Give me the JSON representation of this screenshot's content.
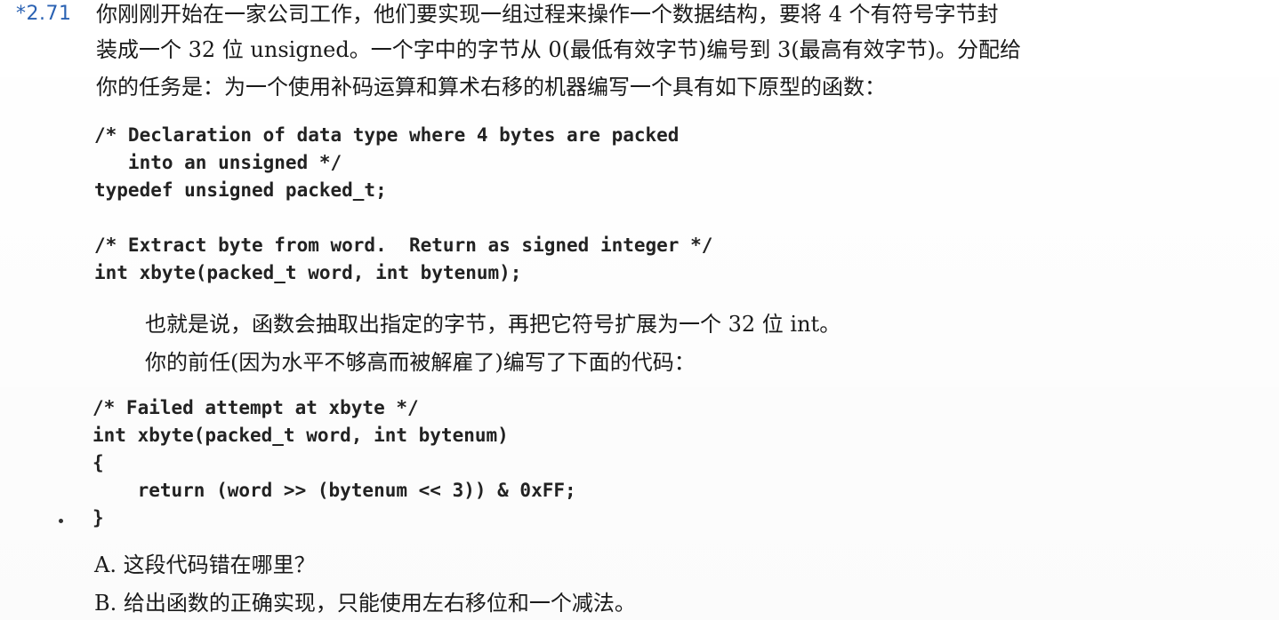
{
  "problem": {
    "number": "*2.71",
    "intro": [
      "你刚刚开始在一家公司工作，他们要实现一组过程来操作一个数据结构，要将 4 个有符号字节封",
      "装成一个 32 位 unsigned。一个字中的字节从 0(最低有效字节)编号到 3(最高有效字节)。分配给",
      "你的任务是：为一个使用补码运算和算术右移的机器编写一个具有如下原型的函数："
    ],
    "code_block_1": "/* Declaration of data type where 4 bytes are packed\n   into an unsigned */\ntypedef unsigned packed_t;\n\n/* Extract byte from word.  Return as signed integer */\nint xbyte(packed_t word, int bytenum);",
    "middle": [
      "也就是说，函数会抽取出指定的字节，再把它符号扩展为一个 32 位 int。",
      "你的前任(因为水平不够高而被解雇了)编写了下面的代码："
    ],
    "code_block_2": "/* Failed attempt at xbyte */\nint xbyte(packed_t word, int bytenum)\n{\n    return (word >> (bytenum << 3)) & 0xFF;\n}",
    "questions": [
      "A. 这段代码错在哪里？",
      "B. 给出函数的正确实现，只能使用左右移位和一个减法。"
    ]
  }
}
